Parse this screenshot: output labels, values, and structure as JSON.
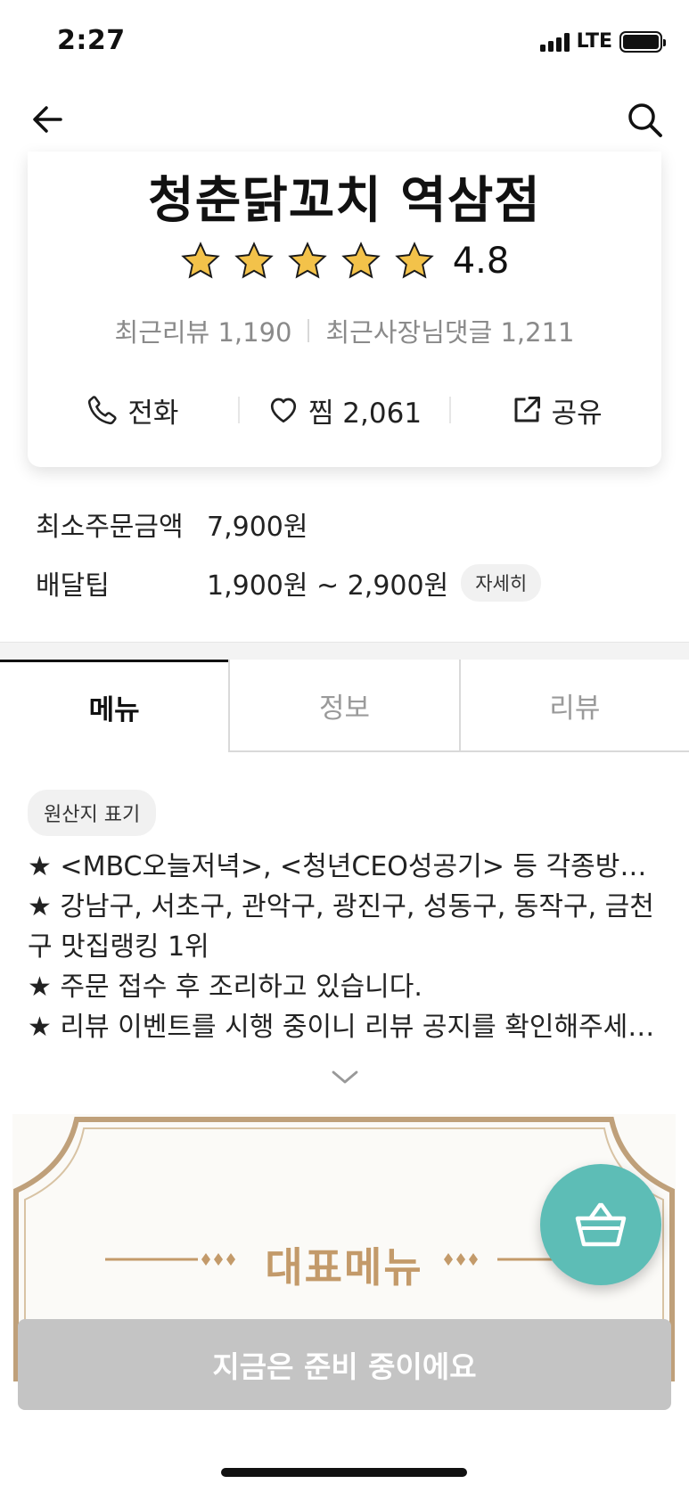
{
  "status_bar": {
    "time": "2:27",
    "network": "LTE"
  },
  "store": {
    "name": "청춘닭꼬치 역삼점",
    "rating": "4.8",
    "stars": 5,
    "recent_reviews": "최근리뷰 1,190",
    "owner_replies": "최근사장님댓글 1,211"
  },
  "actions": {
    "call_label": "전화",
    "like_label": "찜 2,061",
    "share_label": "공유"
  },
  "order_info": {
    "min_order_label": "최소주문금액",
    "min_order_value": "7,900원",
    "delivery_tip_label": "배달팁",
    "delivery_tip_value": "1,900원 ~ 2,900원",
    "detail_button": "자세히"
  },
  "tabs": [
    {
      "label": "메뉴",
      "active": true
    },
    {
      "label": "정보",
      "active": false
    },
    {
      "label": "리뷰",
      "active": false
    }
  ],
  "notice": {
    "origin_button": "원산지 표기",
    "lines": [
      "★ <MBC오늘저녁>, <청년CEO성공기> 등 각종방송 출연",
      "★ 강남구, 서초구, 관악구, 광진구, 성동구, 동작구, 금천구 맛집랭킹 1위",
      "★ 주문 접수 후 조리하고 있습니다.",
      "★ 리뷰 이벤트를 시행 중이니 리뷰 공지를 확인해주세…"
    ]
  },
  "banner": {
    "title": "대표메뉴"
  },
  "bottom_button": {
    "label": "지금은 준비 중이에요"
  },
  "colors": {
    "fab": "#5dbdb6",
    "banner_gold": "#c39a6a",
    "star": "#f3c24a",
    "disabled_button": "#c4c4c4"
  }
}
